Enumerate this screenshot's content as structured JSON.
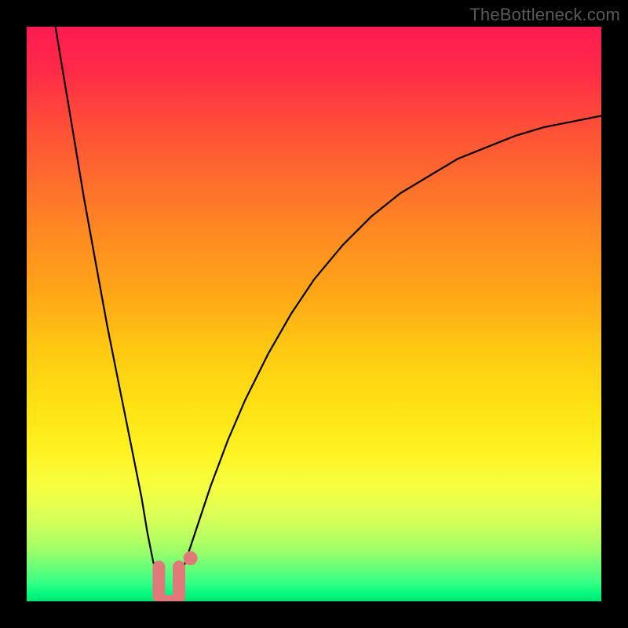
{
  "watermark": "TheBottleneck.com",
  "chart_data": {
    "type": "line",
    "title": "",
    "xlabel": "",
    "ylabel": "",
    "x_range": [
      0,
      100
    ],
    "y_range": [
      0,
      100
    ],
    "background_gradient": {
      "top": "#ff1b52",
      "middle": "#ffe214",
      "bottom": "#00e070"
    },
    "series": [
      {
        "name": "left-branch",
        "x": [
          5,
          6,
          8,
          10,
          12,
          14,
          16,
          18,
          20,
          21,
          22,
          23,
          24,
          25
        ],
        "y": [
          100,
          94,
          82,
          70,
          59,
          48,
          38,
          28,
          18,
          12,
          7,
          3,
          1,
          0
        ]
      },
      {
        "name": "right-branch",
        "x": [
          25,
          26,
          27,
          28,
          30,
          32,
          35,
          38,
          42,
          46,
          50,
          55,
          60,
          65,
          70,
          75,
          80,
          85,
          90,
          95,
          100
        ],
        "y": [
          0,
          2,
          5,
          8,
          14,
          20,
          28,
          35,
          43,
          50,
          56,
          62,
          67,
          71,
          74,
          77,
          79,
          81,
          82.5,
          83.5,
          84.5
        ]
      }
    ],
    "markers": [
      {
        "name": "highlight-u",
        "shape": "u",
        "x_range": [
          23,
          26.5
        ],
        "y_range": [
          0,
          6
        ],
        "color": "#e07a7a"
      },
      {
        "name": "highlight-dot",
        "shape": "dot",
        "x": 28.5,
        "y": 7.5,
        "color": "#e07a7a"
      }
    ]
  }
}
